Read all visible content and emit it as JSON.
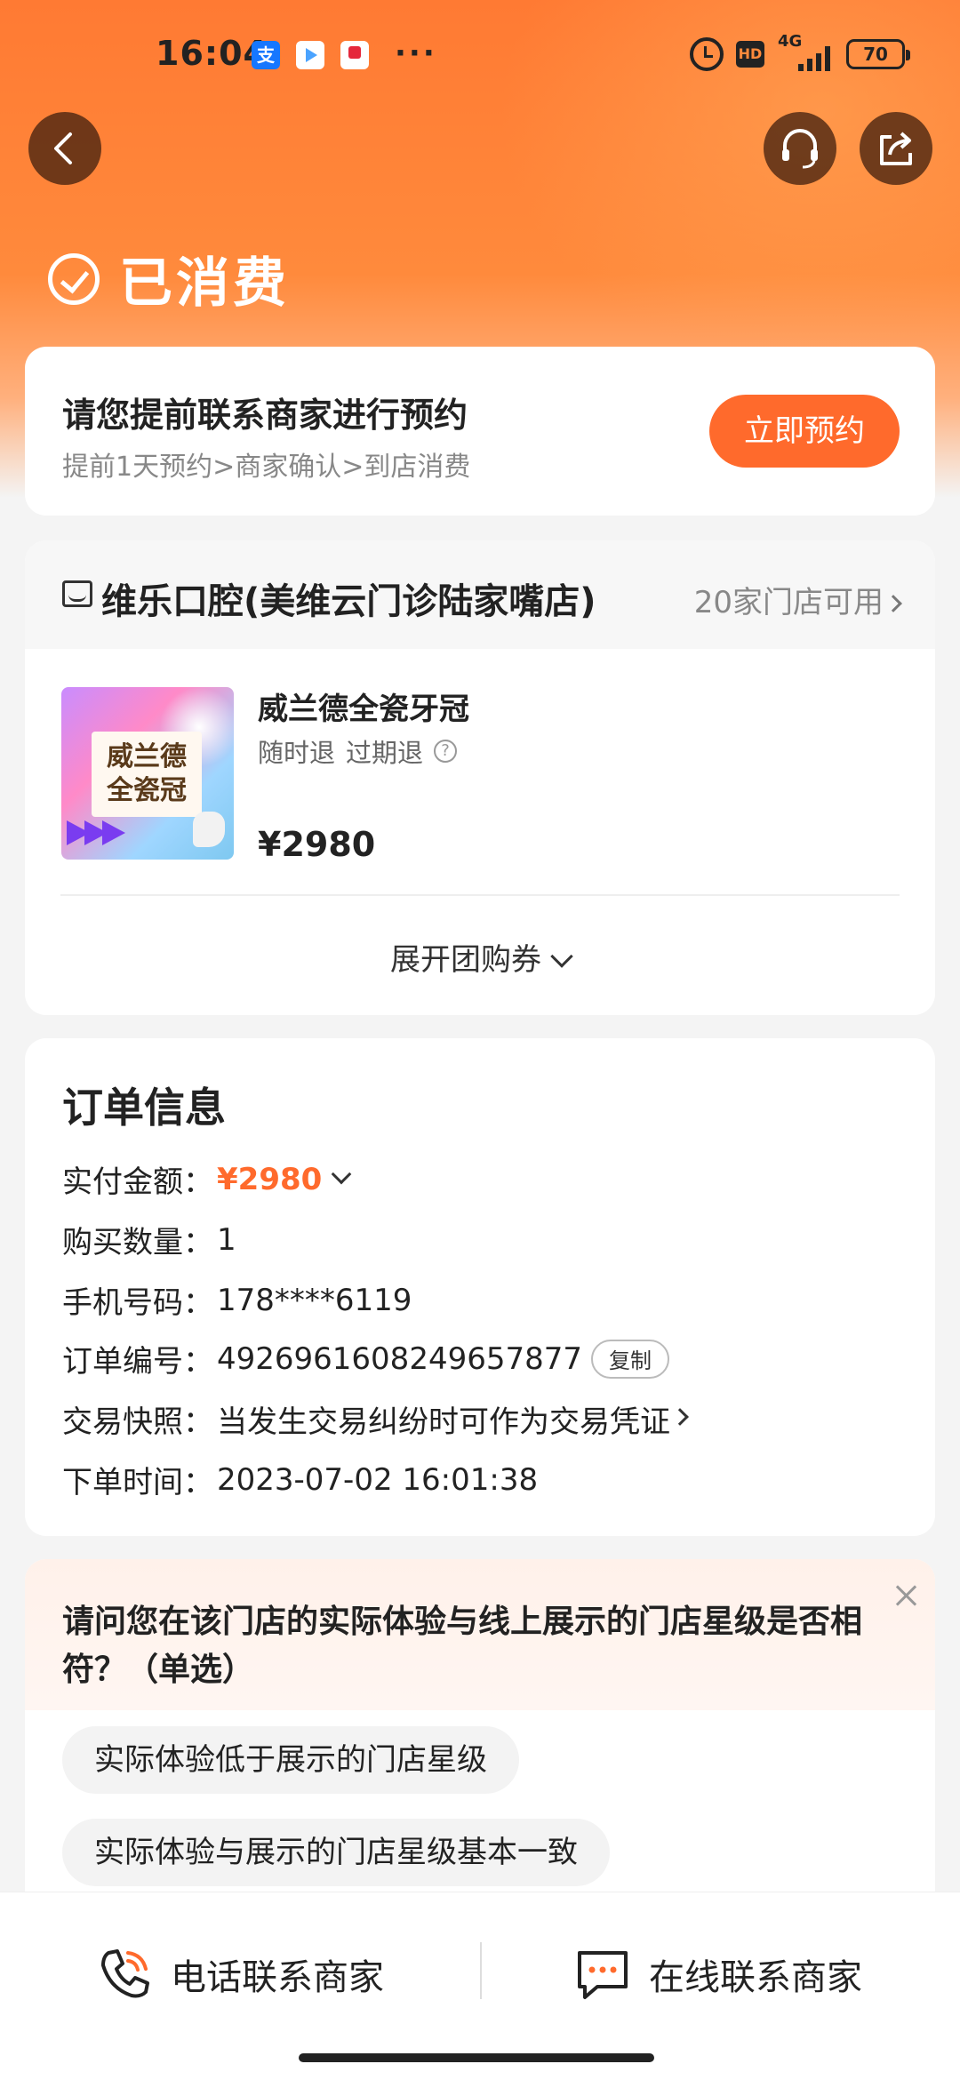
{
  "status_bar": {
    "time": "16:04",
    "more": "···",
    "network": "4G",
    "battery": "70",
    "hd": "HD",
    "alipay_glyph": "支"
  },
  "header": {
    "status_text": "已消费"
  },
  "booking": {
    "title": "请您提前联系商家进行预约",
    "subtitle": "提前1天预约>商家确认>到店消费",
    "button_label": "立即预约"
  },
  "merchant": {
    "name": "维乐口腔(美维云门诊陆家嘴店)",
    "store_count": "20家门店可用",
    "product": {
      "name": "威兰德全瓷牙冠",
      "image_text_line1": "威兰德",
      "image_text_line2": "全瓷冠",
      "tag1": "随时退",
      "tag2": "过期退",
      "price": "¥2980"
    },
    "expand_label": "展开团购券"
  },
  "order": {
    "title": "订单信息",
    "paid_label": "实付金额：",
    "paid_value": "¥2980",
    "qty_label": "购买数量：",
    "qty_value": "1",
    "phone_label": "手机号码：",
    "phone_value": "178****6119",
    "order_no_label": "订单编号：",
    "order_no_value": "4926961608249657877",
    "copy_label": "复制",
    "snapshot_label": "交易快照：",
    "snapshot_value": "当发生交易纠纷时可作为交易凭证",
    "time_label": "下单时间：",
    "time_value": "2023-07-02 16:01:38"
  },
  "survey": {
    "question": "请问您在该门店的实际体验与线上展示的门店星级是否相符？（单选）",
    "options": [
      "实际体验低于展示的门店星级",
      "实际体验与展示的门店星级基本一致"
    ]
  },
  "bottom_bar": {
    "phone_label": "电话联系商家",
    "chat_label": "在线联系商家"
  },
  "colors": {
    "accent": "#ff6a2c",
    "header_orange": "#ff7a33"
  },
  "icons": [
    "back-icon",
    "headset-icon",
    "share-icon",
    "check-circle-icon",
    "store-icon",
    "question-icon",
    "close-icon",
    "phone-icon",
    "chat-icon"
  ]
}
